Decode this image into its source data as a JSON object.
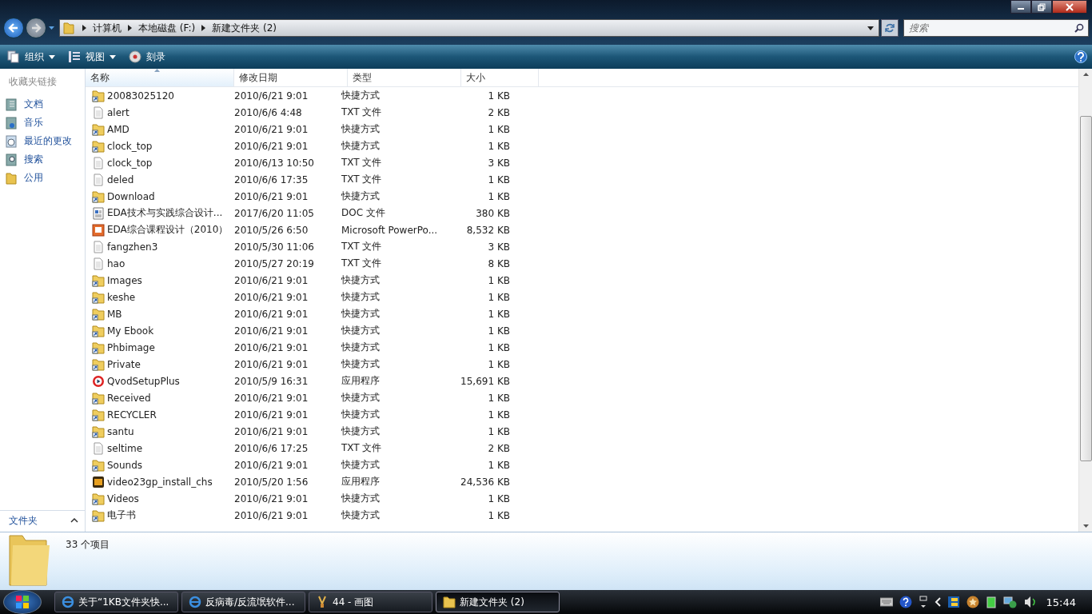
{
  "breadcrumb": [
    "计算机",
    "本地磁盘 (F:)",
    "新建文件夹 (2)"
  ],
  "search": {
    "placeholder": "搜索"
  },
  "toolbar": [
    {
      "label": "组织",
      "kind": "organize",
      "dropdown": true
    },
    {
      "label": "视图",
      "kind": "views",
      "dropdown": true
    },
    {
      "label": "刻录",
      "kind": "burn",
      "dropdown": false
    }
  ],
  "sidebar": {
    "title": "收藏夹链接",
    "items": [
      {
        "label": "文档",
        "kind": "documents"
      },
      {
        "label": "音乐",
        "kind": "music"
      },
      {
        "label": "最近的更改",
        "kind": "recent"
      },
      {
        "label": "搜索",
        "kind": "search"
      },
      {
        "label": "公用",
        "kind": "public"
      }
    ],
    "folders": "文件夹"
  },
  "table": {
    "columns": [
      {
        "label": "名称",
        "sorted": true
      },
      {
        "label": "修改日期",
        "sorted": false
      },
      {
        "label": "类型",
        "sorted": false
      },
      {
        "label": "大小",
        "sorted": false
      }
    ],
    "rows": [
      {
        "name": "20083025120",
        "date": "2010/6/21 9:01",
        "type": "快捷方式",
        "size": "1 KB",
        "kind": "shortcut"
      },
      {
        "name": "alert",
        "date": "2010/6/6 4:48",
        "type": "TXT 文件",
        "size": "2 KB",
        "kind": "text"
      },
      {
        "name": "AMD",
        "date": "2010/6/21 9:01",
        "type": "快捷方式",
        "size": "1 KB",
        "kind": "shortcut"
      },
      {
        "name": "clock_top",
        "date": "2010/6/21 9:01",
        "type": "快捷方式",
        "size": "1 KB",
        "kind": "shortcut"
      },
      {
        "name": "clock_top",
        "date": "2010/6/13 10:50",
        "type": "TXT 文件",
        "size": "3 KB",
        "kind": "text"
      },
      {
        "name": "deled",
        "date": "2010/6/6 17:35",
        "type": "TXT 文件",
        "size": "1 KB",
        "kind": "text"
      },
      {
        "name": "Download",
        "date": "2010/6/21 9:01",
        "type": "快捷方式",
        "size": "1 KB",
        "kind": "shortcut"
      },
      {
        "name": "EDA技术与实践综合设计...",
        "date": "2017/6/20 11:05",
        "type": "DOC 文件",
        "size": "380 KB",
        "kind": "doc"
      },
      {
        "name": "EDA综合课程设计（2010）",
        "date": "2010/5/26 6:50",
        "type": "Microsoft PowerPo...",
        "size": "8,532 KB",
        "kind": "ppt"
      },
      {
        "name": "fangzhen3",
        "date": "2010/5/30 11:06",
        "type": "TXT 文件",
        "size": "3 KB",
        "kind": "text"
      },
      {
        "name": "hao",
        "date": "2010/5/27 20:19",
        "type": "TXT 文件",
        "size": "8 KB",
        "kind": "text"
      },
      {
        "name": "Images",
        "date": "2010/6/21 9:01",
        "type": "快捷方式",
        "size": "1 KB",
        "kind": "shortcut"
      },
      {
        "name": "keshe",
        "date": "2010/6/21 9:01",
        "type": "快捷方式",
        "size": "1 KB",
        "kind": "shortcut"
      },
      {
        "name": "MB",
        "date": "2010/6/21 9:01",
        "type": "快捷方式",
        "size": "1 KB",
        "kind": "shortcut"
      },
      {
        "name": "My Ebook",
        "date": "2010/6/21 9:01",
        "type": "快捷方式",
        "size": "1 KB",
        "kind": "shortcut"
      },
      {
        "name": "Phbimage",
        "date": "2010/6/21 9:01",
        "type": "快捷方式",
        "size": "1 KB",
        "kind": "shortcut"
      },
      {
        "name": "Private",
        "date": "2010/6/21 9:01",
        "type": "快捷方式",
        "size": "1 KB",
        "kind": "shortcut"
      },
      {
        "name": "QvodSetupPlus",
        "date": "2010/5/9 16:31",
        "type": "应用程序",
        "size": "15,691 KB",
        "kind": "player"
      },
      {
        "name": "Received",
        "date": "2010/6/21 9:01",
        "type": "快捷方式",
        "size": "1 KB",
        "kind": "shortcut"
      },
      {
        "name": "RECYCLER",
        "date": "2010/6/21 9:01",
        "type": "快捷方式",
        "size": "1 KB",
        "kind": "shortcut"
      },
      {
        "name": "santu",
        "date": "2010/6/21 9:01",
        "type": "快捷方式",
        "size": "1 KB",
        "kind": "shortcut"
      },
      {
        "name": "seltime",
        "date": "2010/6/6 17:25",
        "type": "TXT 文件",
        "size": "2 KB",
        "kind": "text"
      },
      {
        "name": "Sounds",
        "date": "2010/6/21 9:01",
        "type": "快捷方式",
        "size": "1 KB",
        "kind": "shortcut"
      },
      {
        "name": "video23gp_install_chs",
        "date": "2010/5/20 1:56",
        "type": "应用程序",
        "size": "24,536 KB",
        "kind": "app"
      },
      {
        "name": "Videos",
        "date": "2010/6/21 9:01",
        "type": "快捷方式",
        "size": "1 KB",
        "kind": "shortcut"
      },
      {
        "name": "电子书",
        "date": "2010/6/21 9:01",
        "type": "快捷方式",
        "size": "1 KB",
        "kind": "shortcut"
      }
    ]
  },
  "details": {
    "count": "33 个项目"
  },
  "taskbar": {
    "items": [
      {
        "label": "关于“1KB文件夹快...",
        "kind": "browser",
        "selected": false
      },
      {
        "label": "反病毒/反流氓软件...",
        "kind": "browser",
        "selected": false
      },
      {
        "label": "44 - 画图",
        "kind": "paint",
        "selected": false
      },
      {
        "label": "新建文件夹 (2)",
        "kind": "folder",
        "selected": true
      }
    ],
    "clock": "15:44"
  }
}
